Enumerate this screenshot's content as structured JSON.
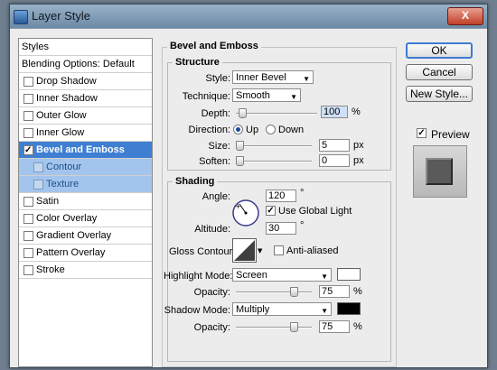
{
  "window": {
    "title": "Layer Style",
    "close_label": "X"
  },
  "sidebar": {
    "items": [
      {
        "label": "Styles"
      },
      {
        "label": "Blending Options: Default"
      },
      {
        "label": "Drop Shadow",
        "checked": false
      },
      {
        "label": "Inner Shadow",
        "checked": false
      },
      {
        "label": "Outer Glow",
        "checked": false
      },
      {
        "label": "Inner Glow",
        "checked": false
      },
      {
        "label": "Bevel and Emboss",
        "checked": true,
        "selected": true
      },
      {
        "label": "Contour",
        "checked": false,
        "sub": true
      },
      {
        "label": "Texture",
        "checked": false,
        "sub": true
      },
      {
        "label": "Satin",
        "checked": false
      },
      {
        "label": "Color Overlay",
        "checked": false
      },
      {
        "label": "Gradient Overlay",
        "checked": false
      },
      {
        "label": "Pattern Overlay",
        "checked": false
      },
      {
        "label": "Stroke",
        "checked": false
      }
    ]
  },
  "bevel": {
    "section_title": "Bevel and Emboss",
    "structure_title": "Structure",
    "style_label": "Style:",
    "style_value": "Inner Bevel",
    "technique_label": "Technique:",
    "technique_value": "Smooth",
    "depth_label": "Depth:",
    "depth_value": "100",
    "depth_unit": "%",
    "direction_label": "Direction:",
    "direction_up": "Up",
    "direction_down": "Down",
    "size_label": "Size:",
    "size_value": "5",
    "size_unit": "px",
    "soften_label": "Soften:",
    "soften_value": "0",
    "soften_unit": "px"
  },
  "shading": {
    "title": "Shading",
    "angle_label": "Angle:",
    "angle_value": "120",
    "angle_unit": "°",
    "global_light_label": "Use Global Light",
    "altitude_label": "Altitude:",
    "altitude_value": "30",
    "altitude_unit": "°",
    "gloss_label": "Gloss Contour:",
    "anti_aliased_label": "Anti-aliased",
    "highlight_mode_label": "Highlight Mode:",
    "highlight_mode_value": "Screen",
    "highlight_color": "#ffffff",
    "highlight_opacity_label": "Opacity:",
    "highlight_opacity_value": "75",
    "highlight_opacity_unit": "%",
    "shadow_mode_label": "Shadow Mode:",
    "shadow_mode_value": "Multiply",
    "shadow_color": "#000000",
    "shadow_opacity_label": "Opacity:",
    "shadow_opacity_value": "75",
    "shadow_opacity_unit": "%"
  },
  "buttons": {
    "ok": "OK",
    "cancel": "Cancel",
    "new_style": "New Style...",
    "preview": "Preview"
  }
}
